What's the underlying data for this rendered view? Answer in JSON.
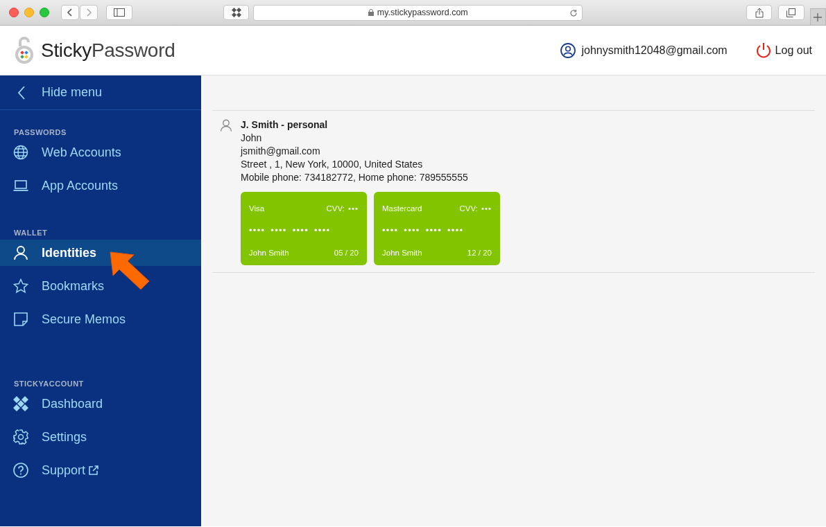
{
  "browser": {
    "address": "my.stickypassword.com"
  },
  "header": {
    "logo_bold": "Sticky",
    "logo_light": "Password",
    "account": "johnysmith12048@gmail.com",
    "logout": "Log out"
  },
  "sidebar": {
    "hide_menu": "Hide menu",
    "sections": [
      {
        "title": "PASSWORDS",
        "items": [
          {
            "label": "Web Accounts",
            "selected": false,
            "external": false
          },
          {
            "label": "App Accounts",
            "selected": false,
            "external": false
          }
        ]
      },
      {
        "title": "WALLET",
        "items": [
          {
            "label": "Identities",
            "selected": true,
            "external": false
          },
          {
            "label": "Bookmarks",
            "selected": false,
            "external": false
          },
          {
            "label": "Secure Memos",
            "selected": false,
            "external": false
          }
        ]
      },
      {
        "title": "STICKYACCOUNT",
        "items": [
          {
            "label": "Dashboard",
            "selected": false,
            "external": false
          },
          {
            "label": "Settings",
            "selected": false,
            "external": false
          },
          {
            "label": "Support",
            "selected": false,
            "external": true
          }
        ]
      }
    ]
  },
  "identities": [
    {
      "title": "J. Smith - personal",
      "lines": [
        "John",
        "jsmith@gmail.com",
        "Street , 1, New York, 10000, United States",
        "Mobile phone: 734182772, Home phone: 789555555"
      ],
      "cards": [
        {
          "type": "Visa",
          "cvv_label": "CVV:",
          "cvv": "•••",
          "number": "•••• •••• •••• ••••",
          "holder": "John Smith",
          "expiry": "05 / 20"
        },
        {
          "type": "Mastercard",
          "cvv_label": "CVV:",
          "cvv": "•••",
          "number": "•••• •••• •••• ••••",
          "holder": "John Smith",
          "expiry": "12 / 20"
        }
      ]
    }
  ]
}
